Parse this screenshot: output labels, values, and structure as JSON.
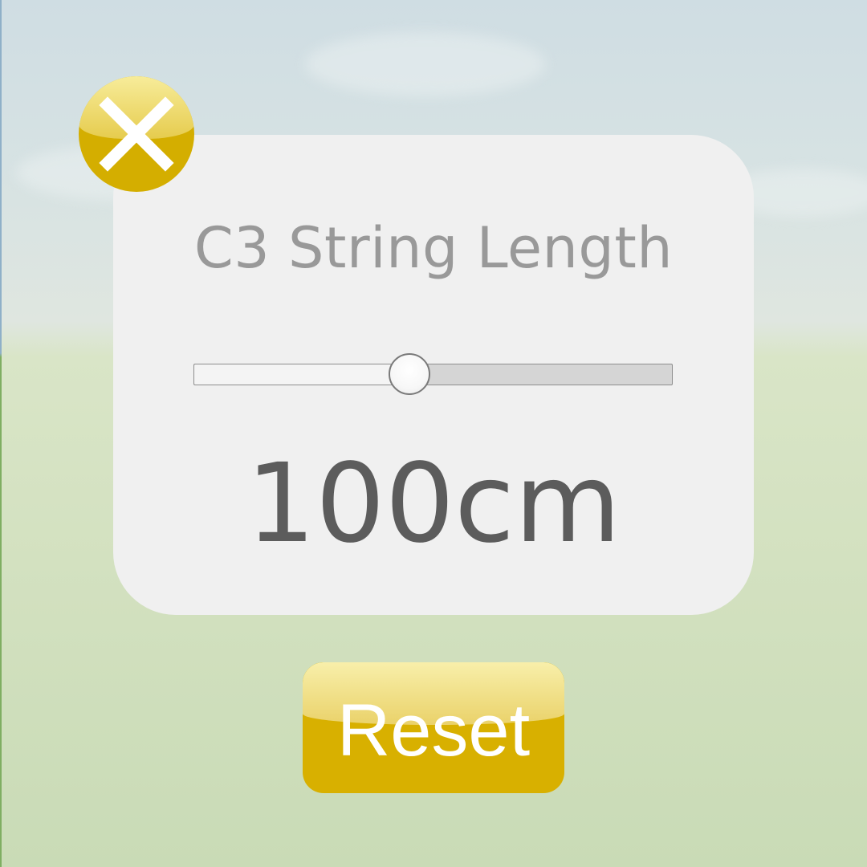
{
  "dialog": {
    "title": "C3 String Length",
    "value_label": "100cm"
  },
  "slider": {
    "level_fraction": 0.45
  },
  "buttons": {
    "reset_label": "Reset",
    "close_icon": "close-icon"
  },
  "colors": {
    "accent_gold": "#d8b000",
    "panel_bg": "#f0f0f0",
    "title_text": "#999999",
    "value_text": "#5c5c5c"
  }
}
